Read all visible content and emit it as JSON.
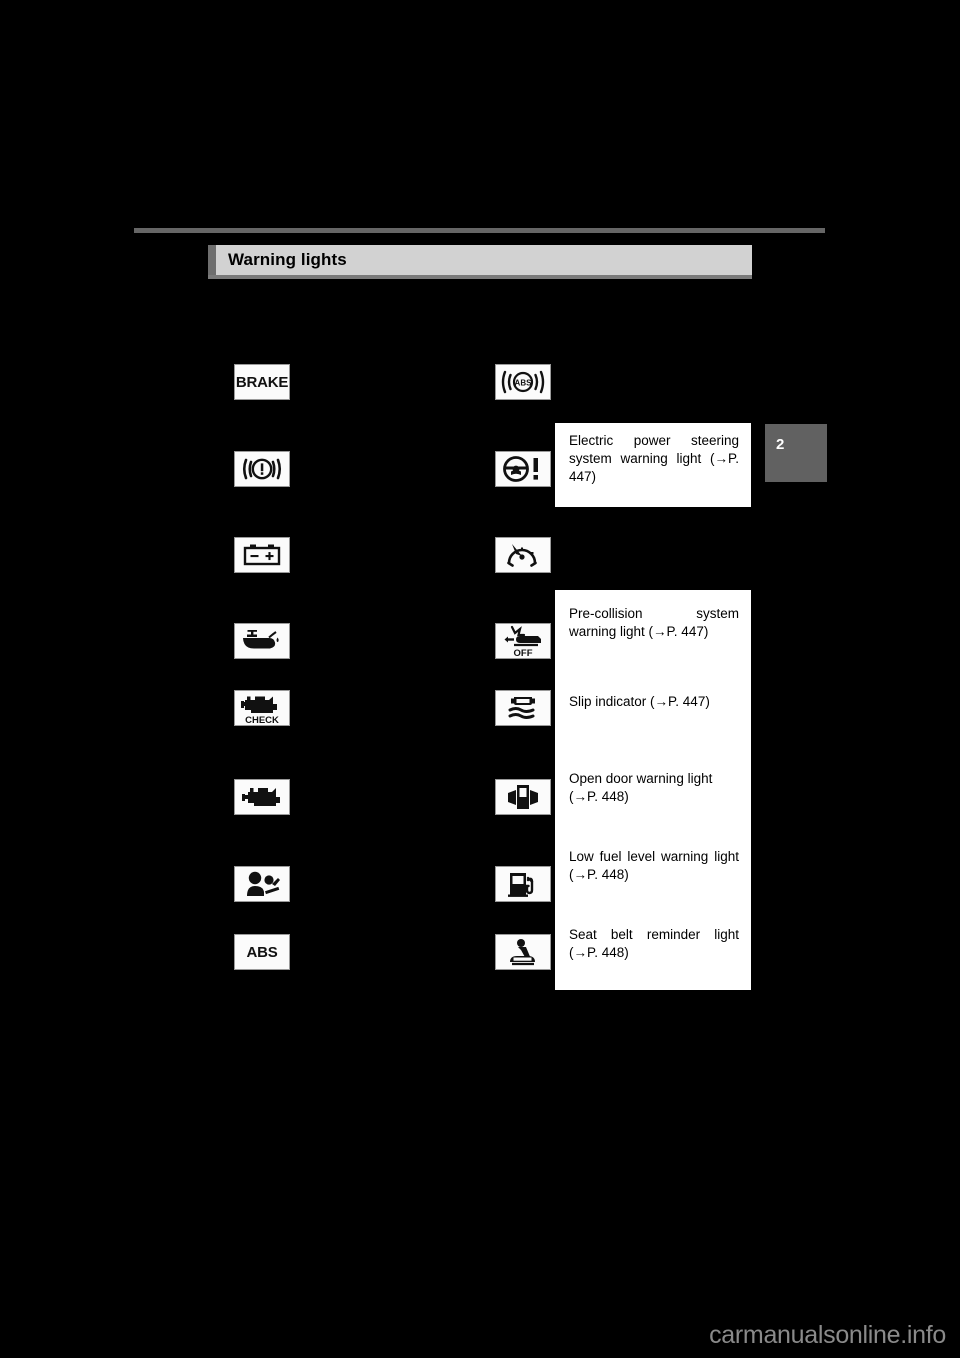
{
  "page": {
    "section_title": "Warning lights",
    "chapter_tab": "2",
    "watermark": "carmanualsonline.info"
  },
  "left_column": [
    {
      "icon": "brake-warning-icon",
      "label": "BRAKE",
      "description": ""
    },
    {
      "icon": "brake-system-circle-exclamation-icon",
      "label": "",
      "description": ""
    },
    {
      "icon": "battery-charge-warning-icon",
      "label": "",
      "description": ""
    },
    {
      "icon": "engine-oil-pressure-warning-icon",
      "label": "",
      "description": ""
    },
    {
      "icon": "engine-check-warning-icon",
      "label": "CHECK",
      "description": ""
    },
    {
      "icon": "malfunction-indicator-icon",
      "label": "",
      "description": ""
    },
    {
      "icon": "srs-airbag-warning-icon",
      "label": "",
      "description": ""
    },
    {
      "icon": "abs-warning-icon",
      "label": "ABS",
      "description": ""
    }
  ],
  "right_column": [
    {
      "icon": "abs-brake-warning-icon",
      "description": ""
    },
    {
      "icon": "electric-power-steering-warning-icon",
      "description": "Electric power steering system warning light (→P. 447)"
    },
    {
      "icon": "cruise-control-speedometer-icon",
      "description": ""
    },
    {
      "icon": "pre-collision-off-icon",
      "description": "Pre-collision system warning light (→P. 447)"
    },
    {
      "icon": "slip-indicator-icon",
      "description": "Slip indicator (→P. 447)"
    },
    {
      "icon": "open-door-warning-icon",
      "description": "Open door warning light (→P. 448)"
    },
    {
      "icon": "low-fuel-level-warning-icon",
      "description": "Low fuel level warning light (→P. 448)"
    },
    {
      "icon": "seat-belt-reminder-icon",
      "description": "Seat belt reminder light (→P. 448)"
    }
  ],
  "colors": {
    "page_background": "#000000",
    "header_bar": "#d2d2d2",
    "header_accent": "#6e6e6e",
    "rule": "#666666",
    "tab": "#616161",
    "panel": "#ffffff",
    "watermark": "#8a8a8a"
  }
}
